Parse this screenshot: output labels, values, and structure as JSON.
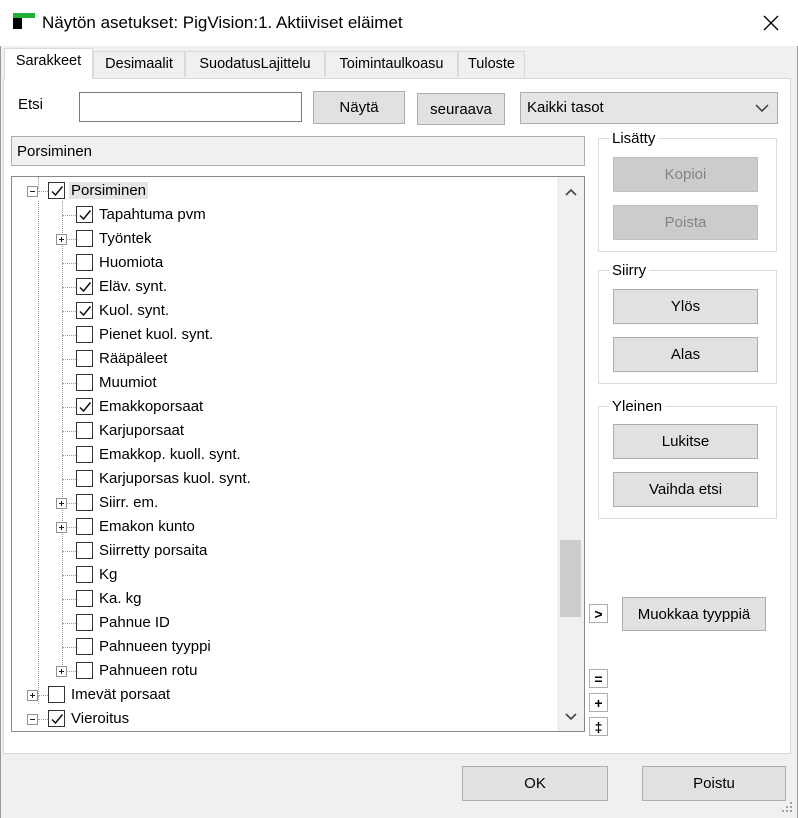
{
  "window": {
    "title": "Näytön asetukset: PigVision:1. Aktiiviset eläimet",
    "close_icon": "close-icon",
    "brand_colors": {
      "green": "#1fae3a",
      "black": "#000000"
    }
  },
  "tabs": [
    {
      "label": "Sarakkeet",
      "active": true
    },
    {
      "label": "Desimaalit"
    },
    {
      "label": "SuodatusLajittelu"
    },
    {
      "label": "Toimintaulkoasu"
    },
    {
      "label": "Tuloste"
    }
  ],
  "search": {
    "label": "Etsi",
    "value": "",
    "show_button": "Näytä",
    "next_button": "seuraava",
    "level_select": "Kaikki tasot"
  },
  "path": "Porsiminen",
  "tree": [
    {
      "label": "Porsiminen",
      "checked": true,
      "level": 0,
      "expander": "minus",
      "selected": true
    },
    {
      "label": "Tapahtuma pvm",
      "checked": true,
      "level": 1
    },
    {
      "label": "Työntek",
      "checked": false,
      "level": 1,
      "expander": "plus"
    },
    {
      "label": "Huomiota",
      "checked": false,
      "level": 1
    },
    {
      "label": "Eläv. synt.",
      "checked": true,
      "level": 1
    },
    {
      "label": "Kuol. synt.",
      "checked": true,
      "level": 1
    },
    {
      "label": "Pienet kuol. synt.",
      "checked": false,
      "level": 1
    },
    {
      "label": "Rääpäleet",
      "checked": false,
      "level": 1
    },
    {
      "label": "Muumiot",
      "checked": false,
      "level": 1
    },
    {
      "label": "Emakkoporsaat",
      "checked": true,
      "level": 1
    },
    {
      "label": "Karjuporsaat",
      "checked": false,
      "level": 1
    },
    {
      "label": "Emakkop. kuoll. synt.",
      "checked": false,
      "level": 1
    },
    {
      "label": "Karjuporsas kuol. synt.",
      "checked": false,
      "level": 1
    },
    {
      "label": "Siirr. em.",
      "checked": false,
      "level": 1,
      "expander": "plus"
    },
    {
      "label": "Emakon kunto",
      "checked": false,
      "level": 1,
      "expander": "plus"
    },
    {
      "label": "Siirretty porsaita",
      "checked": false,
      "level": 1
    },
    {
      "label": "Kg",
      "checked": false,
      "level": 1
    },
    {
      "label": "Ka. kg",
      "checked": false,
      "level": 1
    },
    {
      "label": "Pahnue ID",
      "checked": false,
      "level": 1
    },
    {
      "label": "Pahnueen tyyppi",
      "checked": false,
      "level": 1
    },
    {
      "label": "Pahnueen rotu",
      "checked": false,
      "level": 1,
      "expander": "plus"
    },
    {
      "label": "Imevät porsaat",
      "checked": false,
      "level": 0,
      "expander": "plus"
    },
    {
      "label": "Vieroitus",
      "checked": true,
      "level": 0,
      "expander": "minus"
    }
  ],
  "groups": {
    "added": {
      "title": "Lisätty",
      "copy": "Kopioi",
      "remove": "Poista"
    },
    "move": {
      "title": "Siirry",
      "up": "Ylös",
      "down": "Alas"
    },
    "general": {
      "title": "Yleinen",
      "lock": "Lukitse",
      "switch_search": "Vaihda etsi"
    }
  },
  "edit_type": {
    "arrow": ">",
    "label": "Muokkaa tyyppiä"
  },
  "tree_controls": {
    "collapse": "=",
    "expand": "+",
    "toggle": "‡"
  },
  "footer": {
    "ok": "OK",
    "exit": "Poistu"
  }
}
